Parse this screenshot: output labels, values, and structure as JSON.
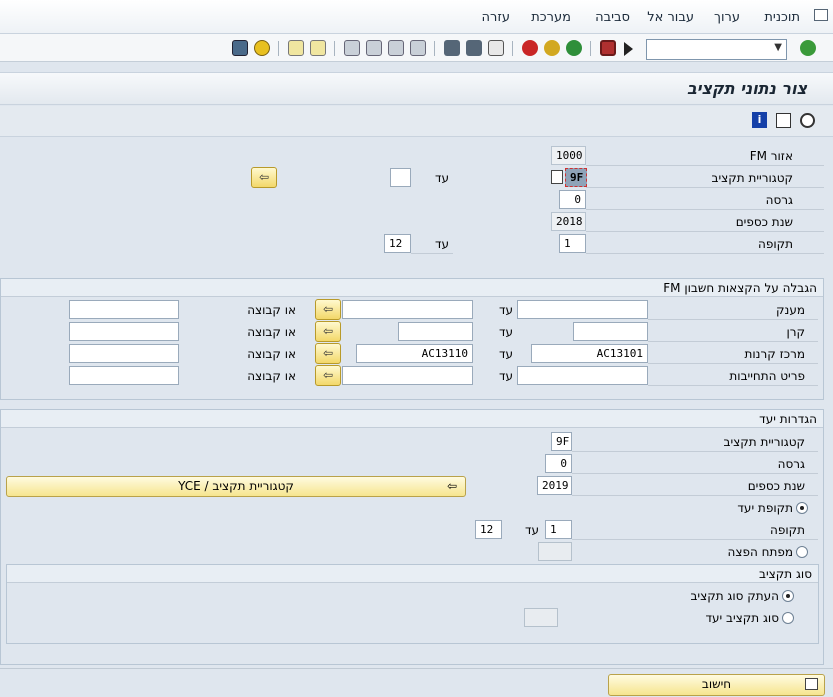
{
  "menu": {
    "items": [
      "תוכנית",
      "ערוך",
      "עבור אל",
      "סביבה",
      "מערכת",
      "עזרה"
    ]
  },
  "toolbar": {
    "command_field": ""
  },
  "title": "צור נתוני תקציב",
  "header": {
    "fm_area_label": "אזור FM",
    "fm_area_value": "1000",
    "budget_category_label": "קטגוריית תקציב",
    "budget_category_value": "9F",
    "to_label": "עד",
    "budget_category_to_value": "",
    "version_label": "גרסה",
    "version_value": "0",
    "fiscal_year_label": "שנת כספים",
    "fiscal_year_value": "2018",
    "period_label": "תקופה",
    "period_value": "1",
    "period_to_value": "12"
  },
  "restrictions": {
    "title": "הגבלה על הקצאות חשבון FM",
    "to_label": "עד",
    "or_group_label": "או קבוצה",
    "rows": [
      {
        "label": "מענק",
        "from": "",
        "to": "",
        "group": ""
      },
      {
        "label": "קרן",
        "from": "",
        "to": "",
        "group": ""
      },
      {
        "label": "מרכז קרנות",
        "from": "AC13101",
        "to": "AC13110",
        "group": ""
      },
      {
        "label": "פריט התחייבות",
        "from": "",
        "to": "",
        "group": ""
      }
    ]
  },
  "target": {
    "title": "הגדרות יעד",
    "budget_category_label": "קטגוריית תקציב",
    "budget_category_value": "9F",
    "version_label": "גרסה",
    "version_value": "0",
    "fiscal_year_label": "שנת כספים",
    "fiscal_year_value": "2019",
    "category_button_label": "קטגוריית תקציב / YCE",
    "target_period_label": "תקופת יעד",
    "period_label": "תקופה",
    "to_label": "עד",
    "period_from_value": "1",
    "period_to_value": "12",
    "distribution_key_label": "מפתח הפצה",
    "distribution_key_value": ""
  },
  "budget_type": {
    "title": "סוג תקציב",
    "copy_label": "העתק סוג תקציב",
    "target_type_label": "סוג תקציב יעד",
    "target_type_value": ""
  },
  "bottom": {
    "calculate_label": "חישוב"
  }
}
